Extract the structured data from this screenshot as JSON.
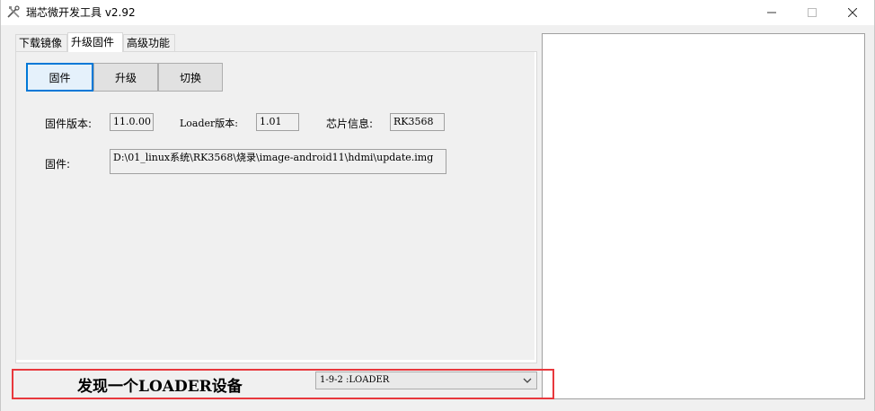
{
  "window": {
    "title": "瑞芯微开发工具 v2.92"
  },
  "tabs": [
    {
      "label": "下载镜像",
      "active": false
    },
    {
      "label": "升级固件",
      "active": true
    },
    {
      "label": "高级功能",
      "active": false
    }
  ],
  "toolbar": {
    "firmware_label": "固件",
    "upgrade_label": "升级",
    "switch_label": "切换"
  },
  "info": {
    "firmware_version_label": "固件版本:",
    "firmware_version_value": "11.0.00",
    "loader_version_label": "Loader版本:",
    "loader_version_value": "1.01",
    "chip_info_label": "芯片信息:",
    "chip_info_value": "RK3568",
    "firmware_path_label": "固件:",
    "firmware_path_value": "D:\\01_linux系统\\RK3568\\烧录\\image-android11\\hdmi\\update.img"
  },
  "status": {
    "message": "发现一个LOADER设备",
    "device_selected": "1-9-2 :LOADER"
  },
  "colors": {
    "highlight_border": "#e8383d",
    "focus_border": "#0078d7"
  },
  "icons": {
    "app": "tools-icon",
    "minimize": "minimize-icon",
    "maximize": "maximize-icon",
    "close": "close-icon",
    "dropdown": "chevron-down-icon"
  }
}
